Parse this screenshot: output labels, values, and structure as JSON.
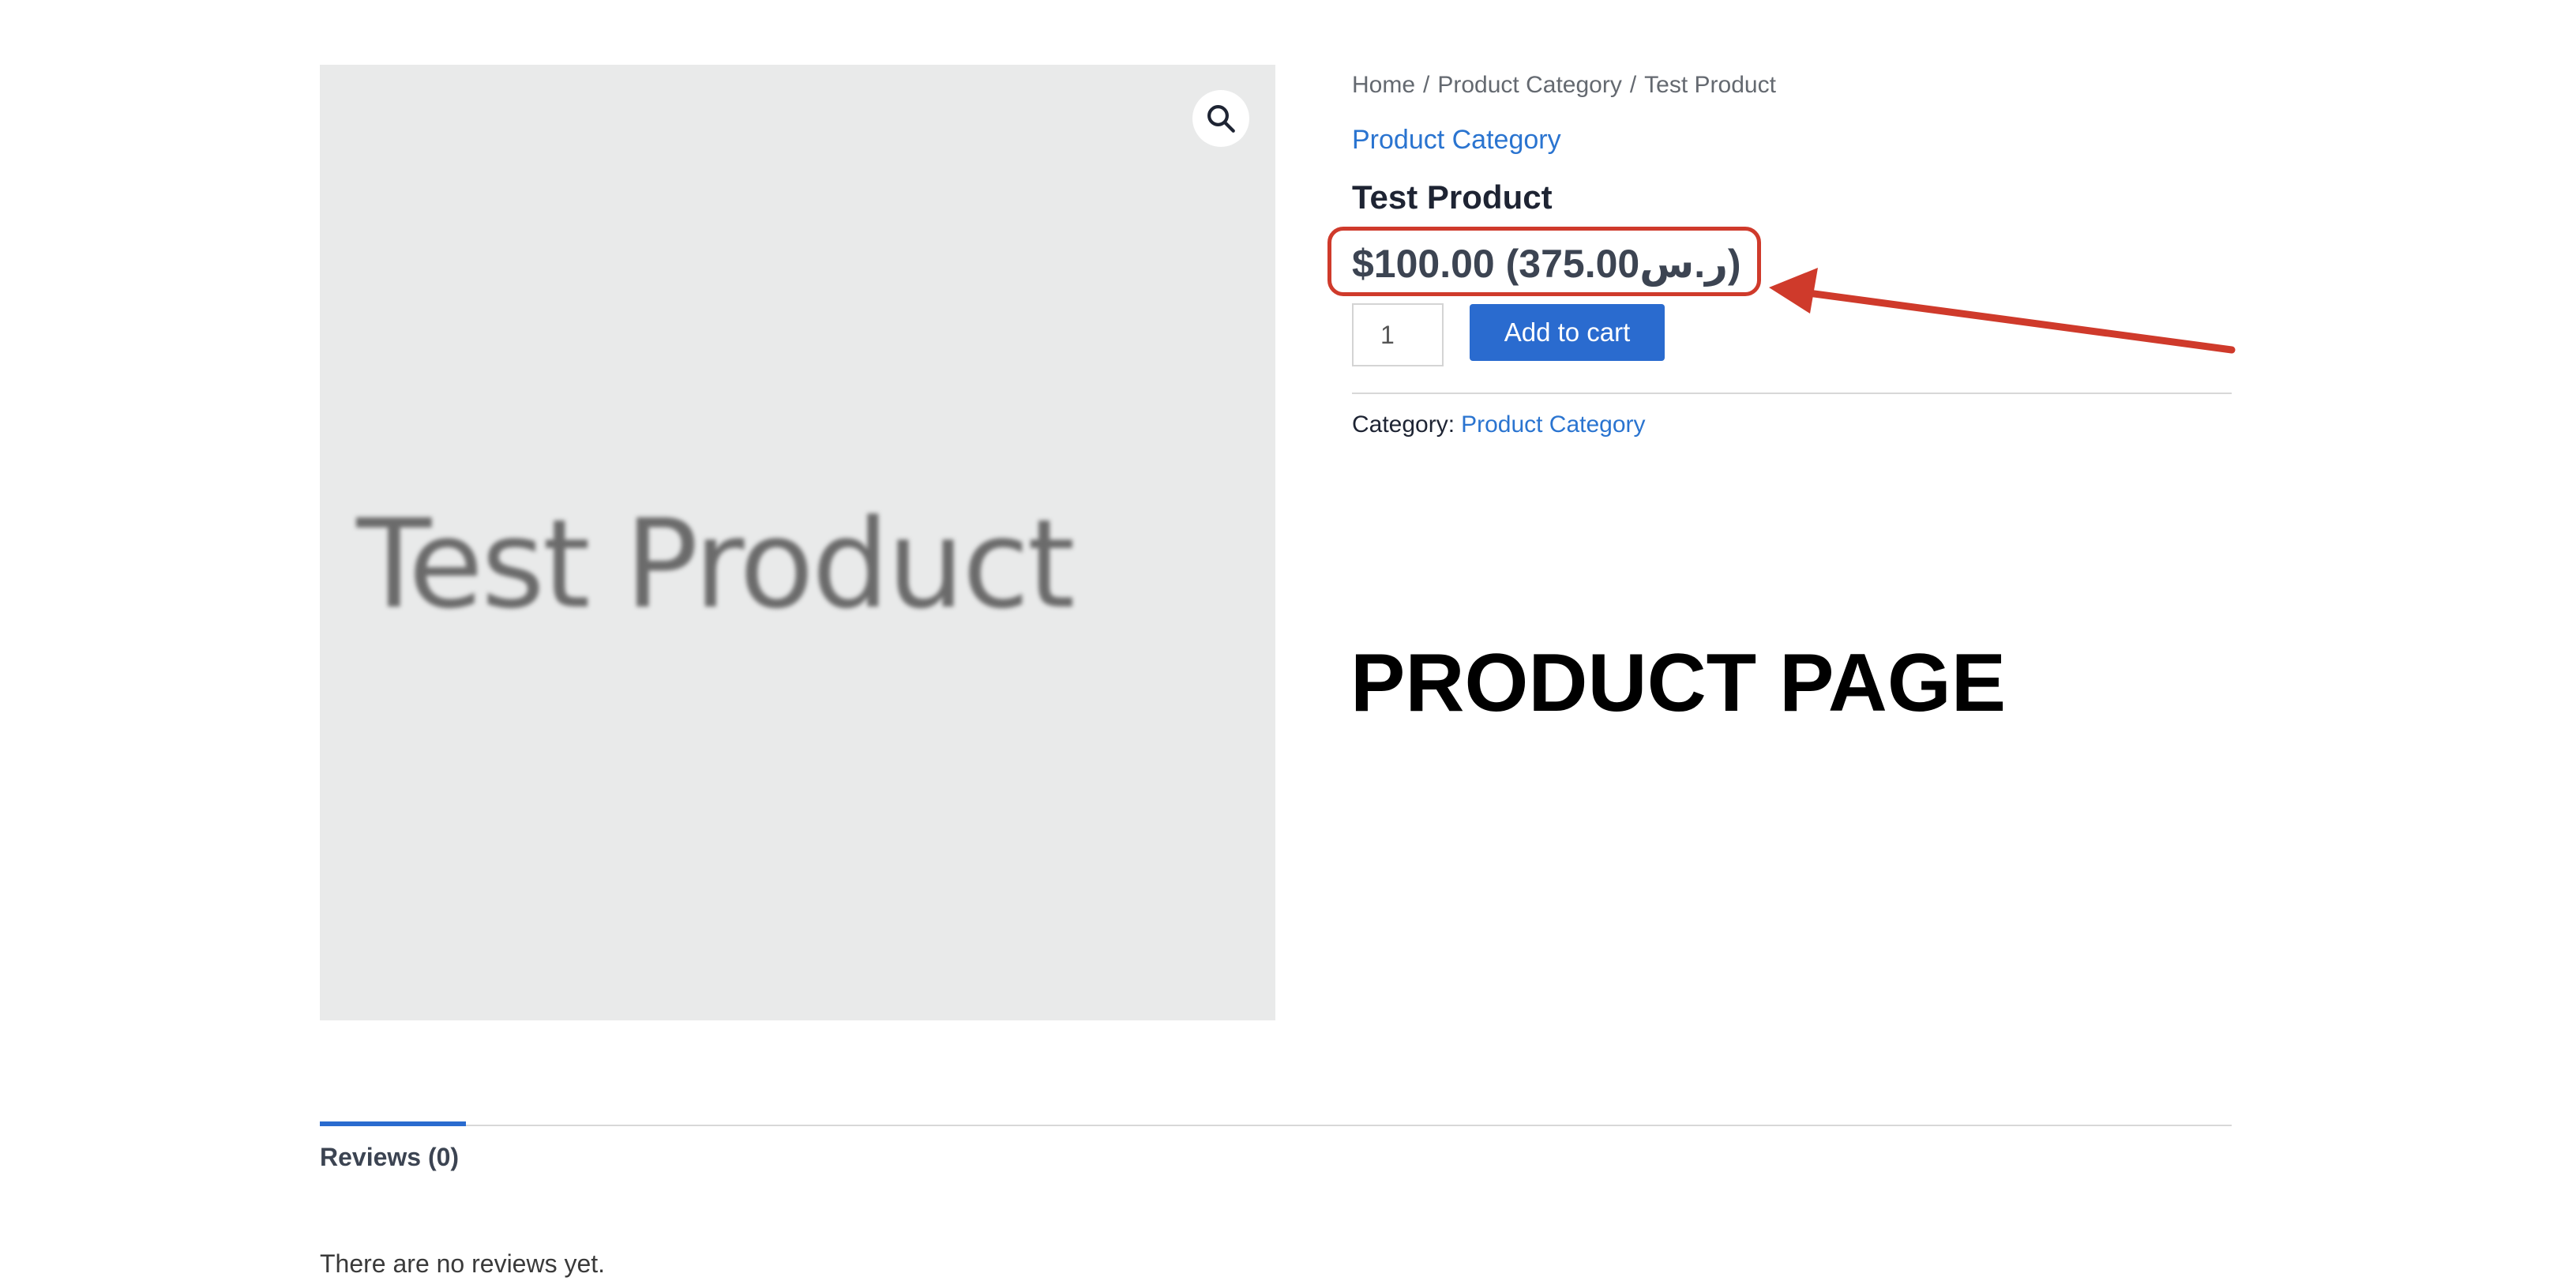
{
  "product_image": {
    "placeholder_text": "Test Product",
    "zoom_icon": "magnifier-icon"
  },
  "breadcrumb": {
    "items": [
      "Home",
      "Product Category",
      "Test Product"
    ],
    "separator": "/"
  },
  "product": {
    "category_link": "Product Category",
    "title": "Test Product",
    "price": "$100.00 (375.00ر.س)",
    "quantity": "1",
    "add_to_cart_label": "Add to cart"
  },
  "meta": {
    "category_label": "Category:",
    "category_value": "Product Category"
  },
  "annotation": {
    "heading": "PRODUCT PAGE",
    "highlight_color": "#cf3a2b"
  },
  "tabs": {
    "items": [
      {
        "label": "Reviews (0)",
        "active": true
      }
    ]
  },
  "reviews": {
    "empty_message": "There are no reviews yet."
  },
  "colors": {
    "link": "#2a74d0",
    "button": "#2a6bcf",
    "image_background": "#e9eaea"
  }
}
